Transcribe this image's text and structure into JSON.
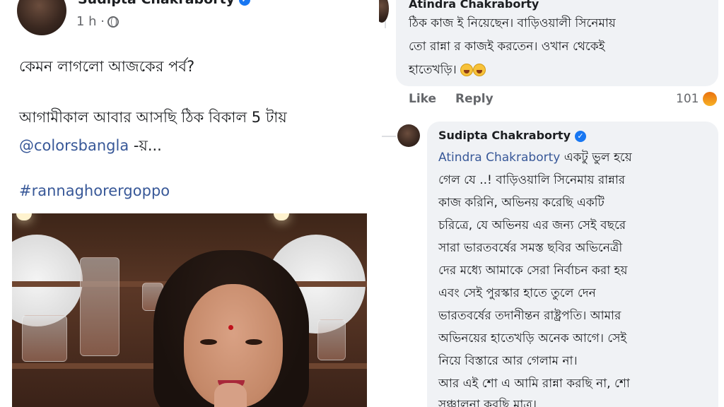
{
  "post": {
    "author": "Sudipta Chakraborty",
    "time": "1 h ·",
    "lines": [
      "কেমন লাগলো আজকের পর্ব?",
      "আগামীকাল আবার আসছি ঠিক বিকাল 5 টায়"
    ],
    "mention": "@colorsbangla",
    "mention_suffix": " -য়...",
    "hashtag": "#rannaghorergoppo"
  },
  "comment1": {
    "author": "Atindra Chakraborty",
    "lines": [
      "ঠিক কাজ ই নিয়েছেন। বাড়িওয়ালী সিনেমায়",
      "তো রান্না র কাজই করতেন। ওখান থেকেই",
      "হাতেখড়ি।"
    ],
    "like_label": "Like",
    "reply_label": "Reply",
    "reaction_count": "101"
  },
  "comment2": {
    "author": "Sudipta Chakraborty",
    "mention": "Atindra Chakraborty",
    "first_line_rest": " একটু ভুল হয়ে",
    "lines": [
      "গেল যে ..! বাড়িওয়ালি সিনেমায় রান্নার",
      "কাজ করিনি, অভিনয় করেছি একটি",
      "চরিত্রে, যে অভিনয় এর জন্য সেই বছরে",
      "সারা ভারতবর্ষের সমস্ত ছবির অভিনেত্রী",
      "দের মধ্যে আমাকে সেরা নির্বাচন করা হয়",
      "এবং সেই পুরস্কার হাতে তুলে দেন",
      "ভারতবর্ষের তদানীন্তন রাষ্ট্রপতি। আমার",
      "অভিনয়ের হাতেখড়ি অনেক আগে। সেই",
      "নিয়ে বিস্তারে আর গেলাম না।",
      "আর এই শো এ আমি রান্না করছি না, শো",
      "সঞ্চালনা করছি মাত্র।"
    ]
  },
  "colors": {
    "link": "#385898",
    "verified": "#1877f2",
    "bubble": "#f0f2f5",
    "meta": "#65676b"
  },
  "icons": [
    "globe-icon",
    "verified-icon",
    "angry-reaction-icon",
    "laugh-emoji-icon"
  ]
}
